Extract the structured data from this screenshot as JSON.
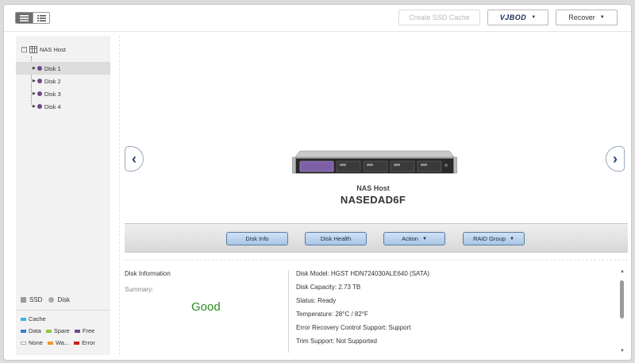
{
  "toolbar": {
    "create_ssd_cache": "Create SSD Cache",
    "vjbod": "VJBOD",
    "recover": "Recover"
  },
  "tree": {
    "root_label": "NAS Host",
    "disks": [
      "Disk 1",
      "Disk 2",
      "Disk 3",
      "Disk 4"
    ],
    "selected_index": 0
  },
  "legend": {
    "ssd": "SSD",
    "disk": "Disk",
    "items": [
      {
        "label": "Cache",
        "color": "#3ab4e6"
      },
      {
        "label": "Data",
        "color": "#3a78d4"
      },
      {
        "label": "Spare",
        "color": "#8cc63e"
      },
      {
        "label": "Free",
        "color": "#6a4a8c"
      },
      {
        "label": "None",
        "color": "#ffffff"
      },
      {
        "label": "Wa...",
        "color": "#f0962a"
      },
      {
        "label": "Error",
        "color": "#c81e1e"
      }
    ]
  },
  "device": {
    "type_label": "NAS Host",
    "name": "NASEDAD6F"
  },
  "actions": {
    "disk_info": "Disk Info",
    "disk_health": "Disk Health",
    "action": "Action",
    "raid_group": "RAID Group"
  },
  "info": {
    "title": "Disk Information",
    "summary_label": "Summary:",
    "summary_value": "Good",
    "details": [
      "Disk Model: HGST HDN724030ALE640 (SATA)",
      "Disk Capacity: 2.73 TB",
      "Status: Ready",
      "Temperature: 28°C / 82°F",
      "Error Recovery Control Support: Support",
      "Trim Support: Not Supported"
    ]
  }
}
